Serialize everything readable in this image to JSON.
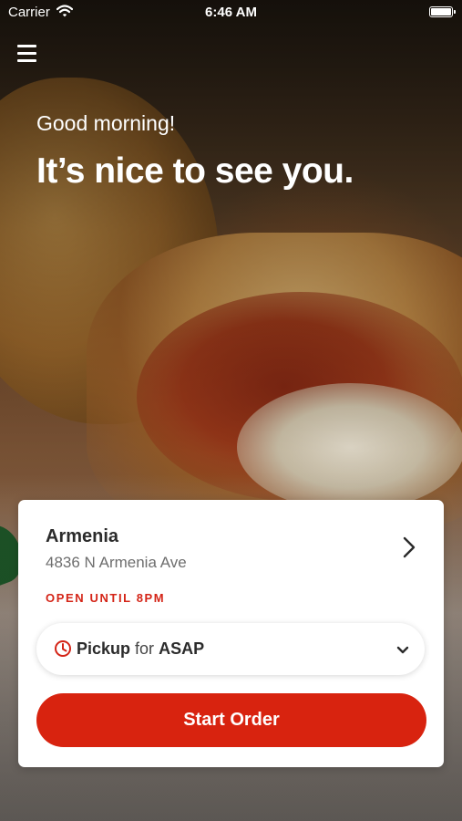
{
  "status_bar": {
    "carrier": "Carrier",
    "time": "6:46 AM"
  },
  "header": {
    "menu_icon": "hamburger-menu-icon",
    "greeting": "Good morning!",
    "headline": "It’s nice to see you."
  },
  "store": {
    "name": "Armenia",
    "address": "4836 N Armenia Ave",
    "hours": "OPEN UNTIL 8PM",
    "chevron_icon": "chevron-right-icon"
  },
  "order_mode": {
    "icon": "clock-icon",
    "mode": "Pickup",
    "connector": "for",
    "time": "ASAP",
    "dropdown_icon": "chevron-down-icon"
  },
  "cta": {
    "label": "Start Order"
  },
  "colors": {
    "accent": "#d8230f",
    "hours_text": "#d42417",
    "card_bg": "#ffffff"
  }
}
